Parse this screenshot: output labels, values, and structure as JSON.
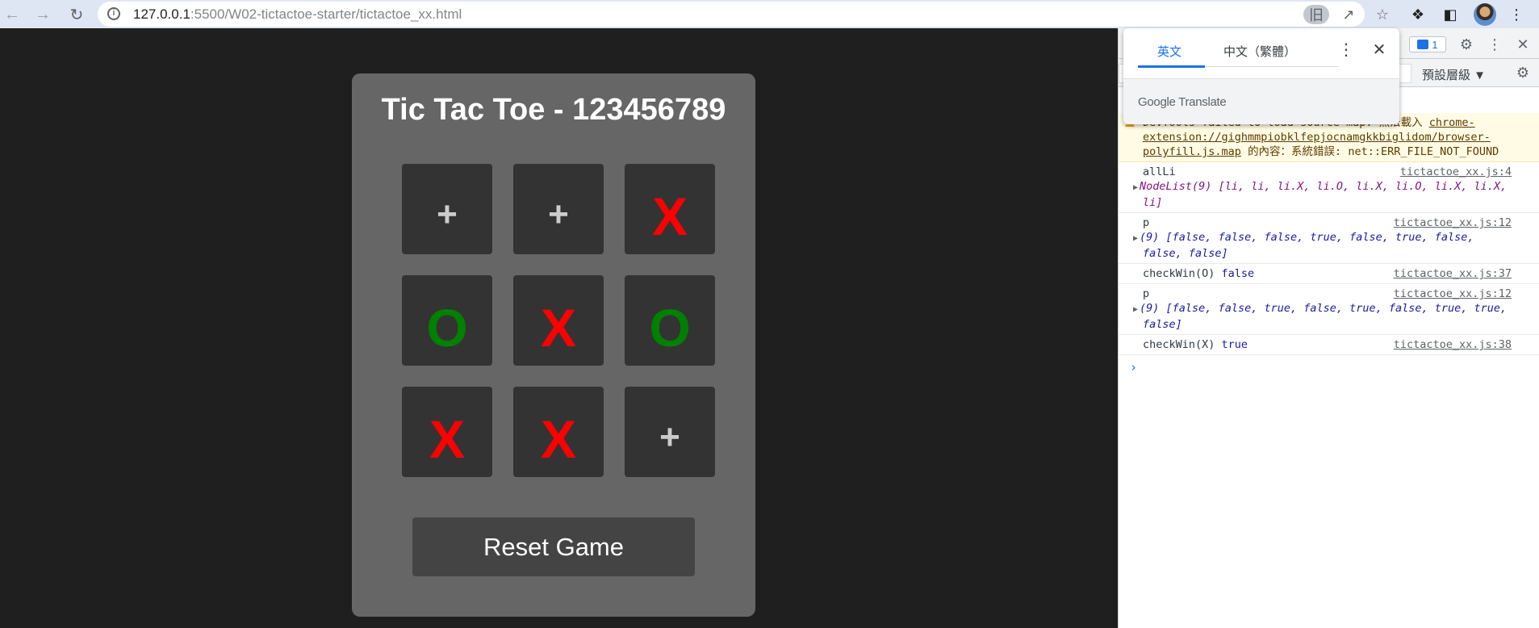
{
  "browser": {
    "url_host": "127.0.0.1",
    "url_path": ":5500/W02-tictactoe-starter/tictactoe_xx.html",
    "icons": [
      "back-arrow-icon",
      "forward-arrow-icon",
      "reload-icon",
      "info-icon",
      "translate-icon",
      "share-icon",
      "star-icon",
      "extensions-icon",
      "side-panel-icon",
      "profile-avatar",
      "kebab-menu-icon"
    ]
  },
  "game": {
    "title": "Tic Tac Toe - 123456789",
    "cells": [
      "+",
      "+",
      "X",
      "O",
      "X",
      "O",
      "X",
      "X",
      "+"
    ],
    "reset_label": "Reset Game",
    "colors": {
      "x": "#ff0000",
      "o": "#008000",
      "empty": "#cccccc",
      "panel": "#666666",
      "cell": "#333333"
    }
  },
  "translate_popup": {
    "tab_source": "英文",
    "tab_target": "中文（繁體）",
    "brand": "Google Translate"
  },
  "devtools": {
    "issues_count": "1",
    "levels_label": "預設層級 ▼",
    "messages": [
      {
        "type": "warning",
        "text_prefix": "DevTools failed to load source map: 無法載入",
        "link": "chrome-extension://gighmmpiobklfepjocnamgkkbiglidom/browser-polyfill.js.map",
        "text_suffix": "的內容：系統錯誤: net::ERR_FILE_NOT_FOUND"
      },
      {
        "label": "allLi",
        "source": "tictactoe_xx.js:4",
        "detail": "NodeList(9) [li, li, li.X, li.O, li.X, li.O, li.X, li.X, li]"
      },
      {
        "label": "p",
        "source": "tictactoe_xx.js:12",
        "detail": "(9) [false, false, false, true, false, true, false, false, false]"
      },
      {
        "label": "checkWin(O)",
        "value": "false",
        "source": "tictactoe_xx.js:37"
      },
      {
        "label": "p",
        "source": "tictactoe_xx.js:12",
        "detail": "(9) [false, false, true, false, true, false, true, true, false]"
      },
      {
        "label": "checkWin(X)",
        "value": "true",
        "source": "tictactoe_xx.js:38"
      }
    ],
    "prompt": "›"
  }
}
